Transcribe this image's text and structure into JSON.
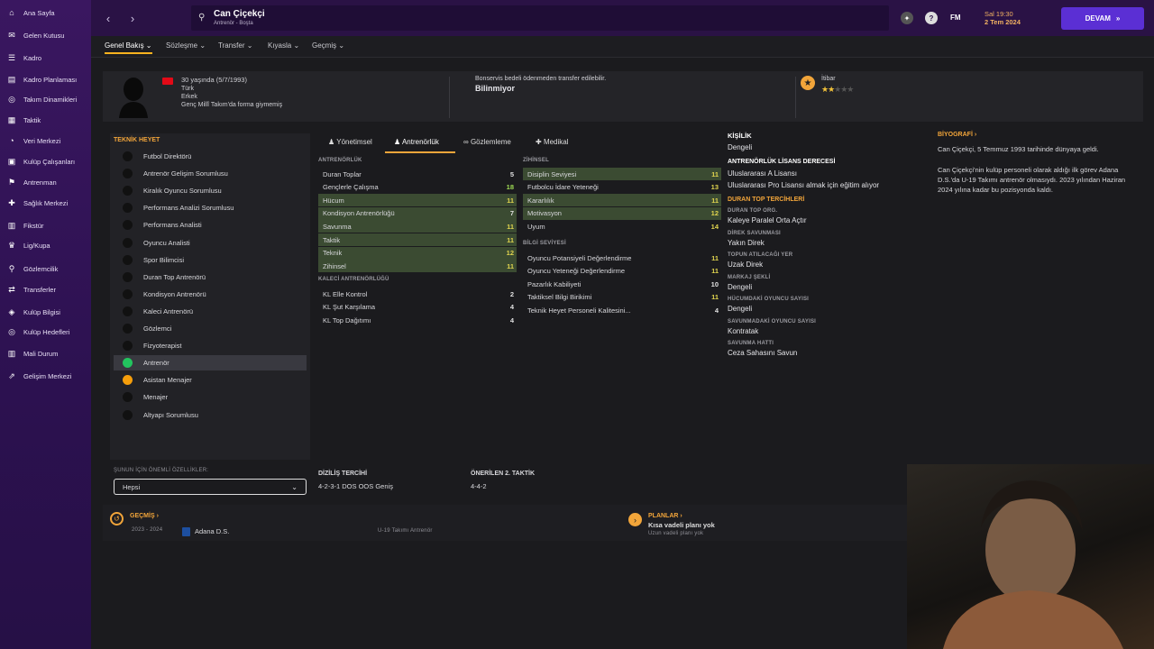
{
  "sidebar": {
    "items": [
      {
        "label": "Ana Sayfa",
        "icon": "home-icon"
      },
      {
        "label": "Gelen Kutusu",
        "icon": "inbox-icon"
      },
      {
        "label": "Kadro",
        "icon": "squad-icon"
      },
      {
        "label": "Kadro Planlaması",
        "icon": "plan-icon"
      },
      {
        "label": "Takım Dinamikleri",
        "icon": "dynamics-icon"
      },
      {
        "label": "Taktik",
        "icon": "tactics-icon"
      },
      {
        "label": "Veri Merkezi",
        "icon": "data-icon"
      },
      {
        "label": "Kulüp Çalışanları",
        "icon": "staff-icon"
      },
      {
        "label": "Antrenman",
        "icon": "training-icon"
      },
      {
        "label": "Sağlık Merkezi",
        "icon": "medical-icon"
      },
      {
        "label": "Fikstür",
        "icon": "calendar-icon"
      },
      {
        "label": "Lig/Kupa",
        "icon": "trophy-icon"
      },
      {
        "label": "Gözlemcilik",
        "icon": "scout-icon"
      },
      {
        "label": "Transferler",
        "icon": "transfer-icon"
      },
      {
        "label": "Kulüp Bilgisi",
        "icon": "shield-icon"
      },
      {
        "label": "Kulüp Hedefleri",
        "icon": "target-icon"
      },
      {
        "label": "Mali Durum",
        "icon": "finance-icon"
      },
      {
        "label": "Gelişim Merkezi",
        "icon": "development-icon"
      }
    ]
  },
  "topbar": {
    "title": "Can Çiçekçi",
    "subtitle": "Antrenör - Boşta",
    "date_line1": "Sal 19:30",
    "date_line2": "2 Tem 2024",
    "fm_label": "FM",
    "continue_label": "DEVAM"
  },
  "subnav": [
    "Genel Bakış",
    "Sözleşme",
    "Transfer",
    "Kıyasla",
    "Geçmiş"
  ],
  "profile": {
    "age": "30 yaşında (5/7/1993)",
    "nationality": "Türk",
    "gender": "Erkek",
    "intl": "Genç Millî Takım'da forma giymemiş",
    "transfer_note": "Bonservis bedeli ödenmeden transfer edilebilir.",
    "transfer_value": "Bilinmiyor",
    "reputation_label": "İtibar",
    "reputation_stars": 1.5
  },
  "staff_panel": {
    "title": "TEKNİK HEYET",
    "items": [
      {
        "label": "Futbol Direktörü",
        "color": "#111"
      },
      {
        "label": "Antrenör Gelişim Sorumlusu",
        "color": "#111"
      },
      {
        "label": "Kiralık Oyuncu Sorumlusu",
        "color": "#111"
      },
      {
        "label": "Performans Analizi Sorumlusu",
        "color": "#111"
      },
      {
        "label": "Performans Analisti",
        "color": "#111"
      },
      {
        "label": "Oyuncu Analisti",
        "color": "#111"
      },
      {
        "label": "Spor Bilimcisi",
        "color": "#111"
      },
      {
        "label": "Duran Top Antrenörü",
        "color": "#111"
      },
      {
        "label": "Kondisyon Antrenörü",
        "color": "#111"
      },
      {
        "label": "Kaleci Antrenörü",
        "color": "#111"
      },
      {
        "label": "Gözlemci",
        "color": "#111"
      },
      {
        "label": "Fizyoterapist",
        "color": "#111"
      },
      {
        "label": "Antrenör",
        "color": "#22c55e"
      },
      {
        "label": "Asistan Menajer",
        "color": "#f59e0b"
      },
      {
        "label": "Menajer",
        "color": "#111"
      },
      {
        "label": "Altyapı Sorumlusu",
        "color": "#111"
      }
    ],
    "filter_label": "ŞUNUN İÇİN ÖNEMLİ ÖZELLİKLER:",
    "filter_value": "Hepsi"
  },
  "tabs": [
    "Yönetimsel",
    "Antrenörlük",
    "Gözlemleme",
    "Medikal"
  ],
  "coaching": {
    "title": "ANTRENÖRLÜK",
    "rows": [
      {
        "label": "Duran Toplar",
        "value": "5",
        "hl": false,
        "c": "w"
      },
      {
        "label": "Gençlerle Çalışma",
        "value": "18",
        "hl": false,
        "c": "g"
      },
      {
        "label": "Hücum",
        "value": "11",
        "hl": true,
        "c": "y"
      },
      {
        "label": "Kondisyon Antrenörlüğü",
        "value": "7",
        "hl": true,
        "c": "w"
      },
      {
        "label": "Savunma",
        "value": "11",
        "hl": true,
        "c": "y"
      },
      {
        "label": "Taktik",
        "value": "11",
        "hl": true,
        "c": "y"
      },
      {
        "label": "Teknik",
        "value": "12",
        "hl": true,
        "c": "y"
      },
      {
        "label": "Zihinsel",
        "value": "11",
        "hl": true,
        "c": "y"
      }
    ]
  },
  "gk": {
    "title": "KALECİ ANTRENÖRLÜĞÜ",
    "rows": [
      {
        "label": "KL Elle Kontrol",
        "value": "2",
        "hl": false,
        "c": "w"
      },
      {
        "label": "KL Şut Karşılama",
        "value": "4",
        "hl": false,
        "c": "w"
      },
      {
        "label": "KL Top Dağıtımı",
        "value": "4",
        "hl": false,
        "c": "w"
      }
    ]
  },
  "mental": {
    "title": "ZİHİNSEL",
    "rows": [
      {
        "label": "Disiplin Seviyesi",
        "value": "11",
        "hl": true,
        "c": "y"
      },
      {
        "label": "Futbolcu İdare Yeteneği",
        "value": "13",
        "hl": false,
        "c": "y"
      },
      {
        "label": "Kararlılık",
        "value": "11",
        "hl": true,
        "c": "y"
      },
      {
        "label": "Motivasyon",
        "value": "12",
        "hl": true,
        "c": "y"
      },
      {
        "label": "Uyum",
        "value": "14",
        "hl": false,
        "c": "y"
      }
    ]
  },
  "knowledge": {
    "title": "BİLGİ SEVİYESİ",
    "rows": [
      {
        "label": "Oyuncu Potansiyeli Değerlendirme",
        "value": "11",
        "hl": false,
        "c": "y"
      },
      {
        "label": "Oyuncu Yeteneği Değerlendirme",
        "value": "11",
        "hl": false,
        "c": "y"
      },
      {
        "label": "Pazarlık Kabiliyeti",
        "value": "10",
        "hl": false,
        "c": "w"
      },
      {
        "label": "Taktiksel Bilgi Birikimi",
        "value": "11",
        "hl": false,
        "c": "y"
      },
      {
        "label": "Teknik Heyet Personeli Kalitesini...",
        "value": "4",
        "hl": false,
        "c": "w"
      }
    ]
  },
  "formation": {
    "label": "DİZİLİŞ TERCİHİ",
    "value": "4-2-3-1 DOS OOS Geniş",
    "alt_label": "ÖNERİLEN 2. TAKTİK",
    "alt_value": "4-4-2"
  },
  "personality": {
    "kisilik_label": "KİŞİLİK",
    "kisilik": "Dengeli",
    "license_label": "ANTRENÖRLÜK LİSANS DERECESİ",
    "license": "Uluslararası A Lisansı",
    "license_note": "Uluslararası Pro Lisansı almak için eğitim alıyor",
    "setpiece_label": "DURAN TOP TERCİHLERİ",
    "prefs": [
      {
        "label": "DURAN TOP ORG.",
        "value": "Kaleye Paralel Orta Açtır"
      },
      {
        "label": "DİREK SAVUNMASI",
        "value": "Yakın Direk"
      },
      {
        "label": "TOPUN ATILACAĞI YER",
        "value": "Uzak Direk"
      },
      {
        "label": "MARKAJ ŞEKLİ",
        "value": "Dengeli"
      },
      {
        "label": "HÜCUMDAKİ OYUNCU SAYISI",
        "value": "Dengeli"
      },
      {
        "label": "SAVUNMADAKİ OYUNCU SAYISI",
        "value": "Kontratak"
      },
      {
        "label": "SAVUNMA HATTI",
        "value": "Ceza Sahasını Savun"
      }
    ]
  },
  "bio": {
    "title": "BİYOGRAFİ",
    "p1": "Can Çiçekçi, 5 Temmuz 1993 tarihinde dünyaya geldi.",
    "p2": "Can Çiçekçi'nin kulüp personeli olarak aldığı ilk görev Adana D.S.'da U-19 Takımı antrenör olmasıydı. 2023 yılından Haziran 2024 yılına kadar bu pozisyonda kaldı."
  },
  "history": {
    "title": "GEÇMİŞ",
    "years": "2023 - 2024",
    "club": "Adana D.S.",
    "role": "U-19 Takımı Antrenör"
  },
  "plans": {
    "title": "PLANLAR",
    "short": "Kısa vadeli planı yok",
    "long": "Uzun vadeli planı yok"
  },
  "colors": {
    "accent": "#f2a53a",
    "continue": "#5b2fd4",
    "highlight": "#3b4b32",
    "sidebar": "#2c1150"
  }
}
